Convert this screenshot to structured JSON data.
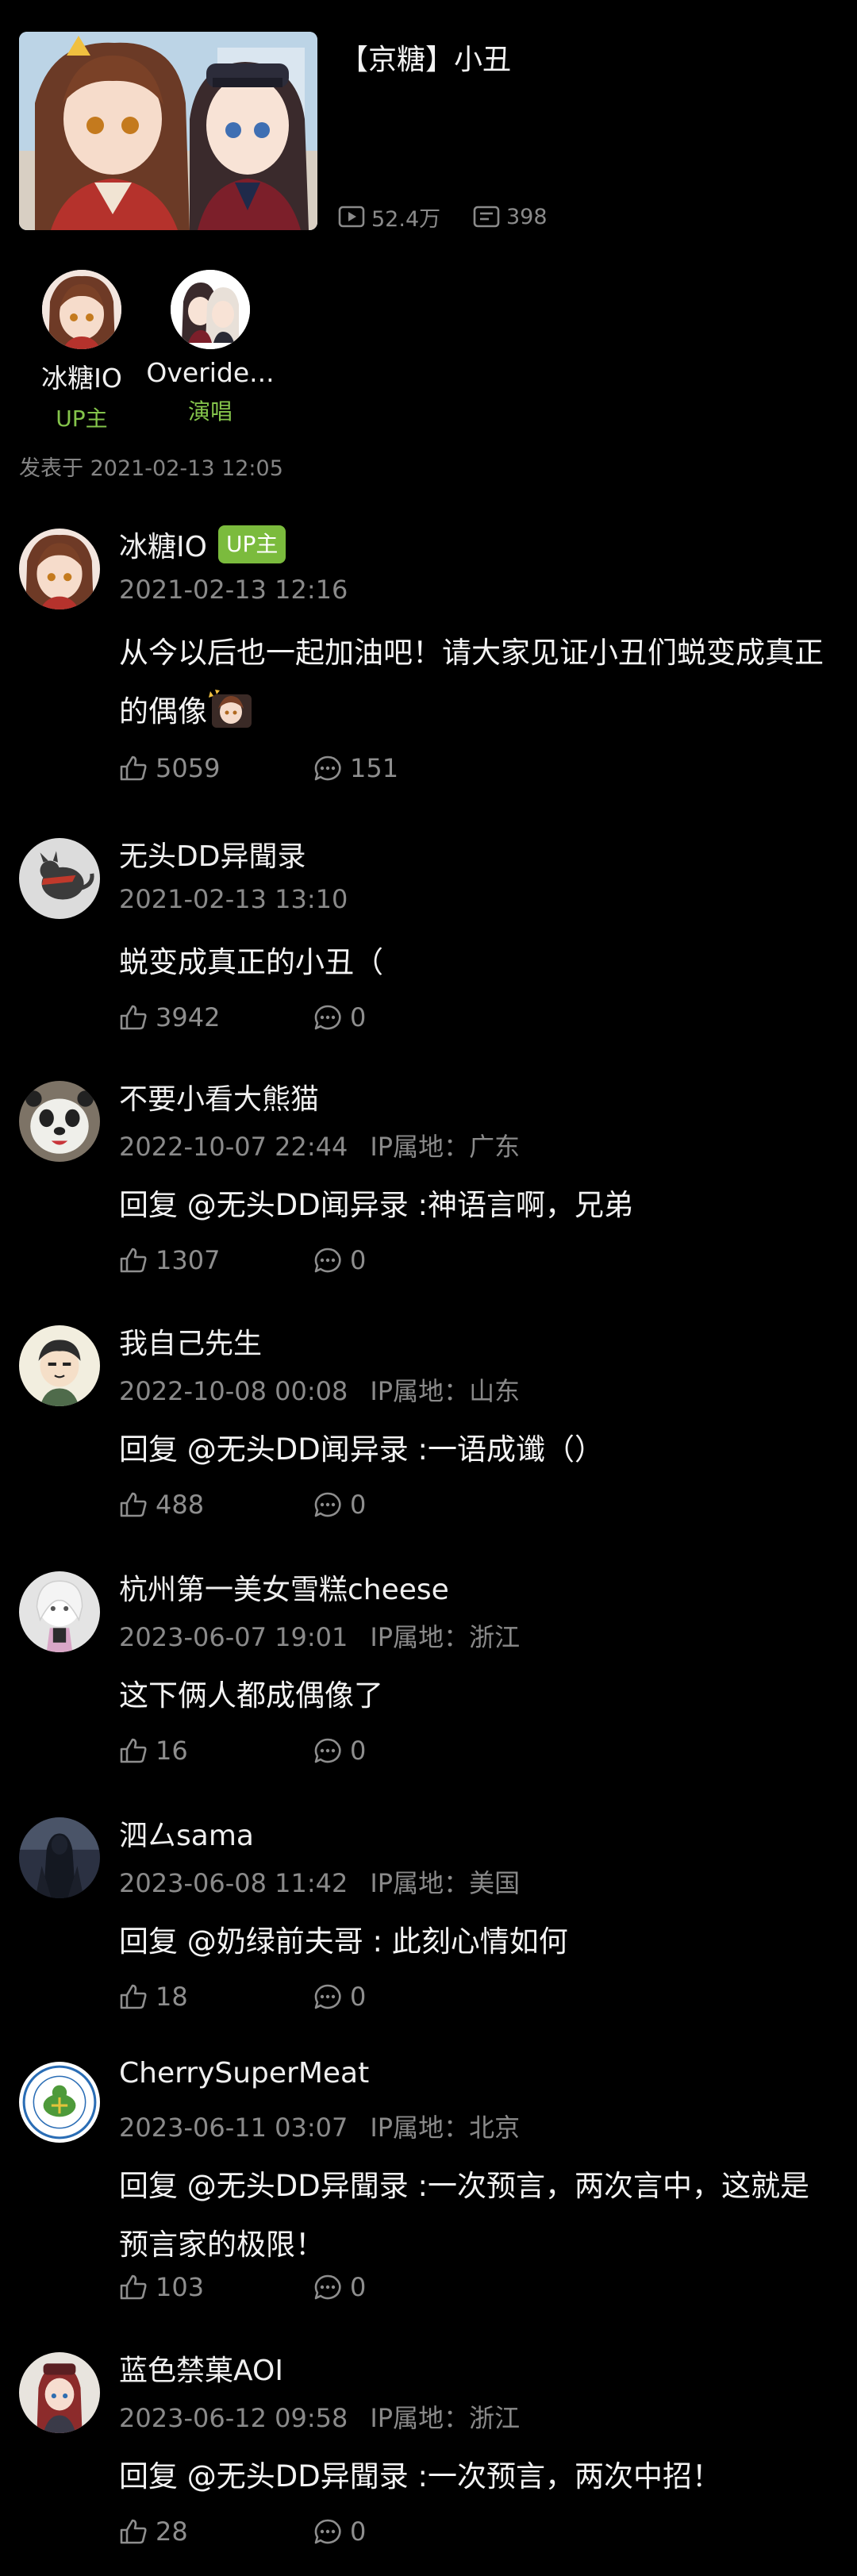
{
  "song": {
    "title": "【京糖】小丑",
    "plays": "52.4万",
    "danmaku": "398",
    "published": "发表于 2021-02-13 12:05"
  },
  "credits": [
    {
      "name": "冰糖IO",
      "role": "UP主"
    },
    {
      "name": "Overide...",
      "role": "演唱"
    }
  ],
  "comments": [
    {
      "user": "冰糖IO",
      "badge": "UP主",
      "date": "2021-02-13 12:16",
      "ip": "",
      "text": "从今以后也一起加油吧！请大家见证小丑们蜕变成真正的偶像",
      "likes": "5059",
      "replies": "151"
    },
    {
      "user": "无头DD异聞录",
      "badge": "",
      "date": "2021-02-13 13:10",
      "ip": "",
      "text": "蜕变成真正的小丑（",
      "likes": "3942",
      "replies": "0"
    },
    {
      "user": "不要小看大熊猫",
      "badge": "",
      "date": "2022-10-07 22:44",
      "ip": "IP属地：广东",
      "text": "回复 @无头DD闻异录 :神语言啊，兄弟",
      "likes": "1307",
      "replies": "0"
    },
    {
      "user": "我自己先生",
      "badge": "",
      "date": "2022-10-08 00:08",
      "ip": "IP属地：山东",
      "text": "回复 @无头DD闻异录 :一语成谶（）",
      "likes": "488",
      "replies": "0"
    },
    {
      "user": "杭州第一美女雪糕cheese",
      "badge": "",
      "date": "2023-06-07 19:01",
      "ip": "IP属地：浙江",
      "text": "这下俩人都成偶像了",
      "likes": "16",
      "replies": "0"
    },
    {
      "user": "泗厶sama",
      "badge": "",
      "date": "2023-06-08 11:42",
      "ip": "IP属地：美国",
      "text": "回复 @奶绿前夫哥 : 此刻心情如何",
      "likes": "18",
      "replies": "0"
    },
    {
      "user": "CherrySuperMeat",
      "badge": "",
      "date": "2023-06-11 03:07",
      "ip": "IP属地：北京",
      "text": "回复 @无头DD异聞录 :一次预言，两次言中，这就是预言家的极限！",
      "likes": "103",
      "replies": "0"
    },
    {
      "user": "蓝色禁菓AOI",
      "badge": "",
      "date": "2023-06-12 09:58",
      "ip": "IP属地：浙江",
      "text": "回复 @无头DD异聞录 :一次预言，两次中招！",
      "likes": "28",
      "replies": "0"
    }
  ],
  "icons": {
    "play": "play-count-icon",
    "danmaku": "danmaku-icon",
    "like": "thumbs-up-icon",
    "reply": "comment-bubble-icon"
  },
  "colors": {
    "background": "#000000",
    "accent_green": "#84c44b",
    "badge_green": "#7bbb3d",
    "muted": "#8a8a8a"
  }
}
